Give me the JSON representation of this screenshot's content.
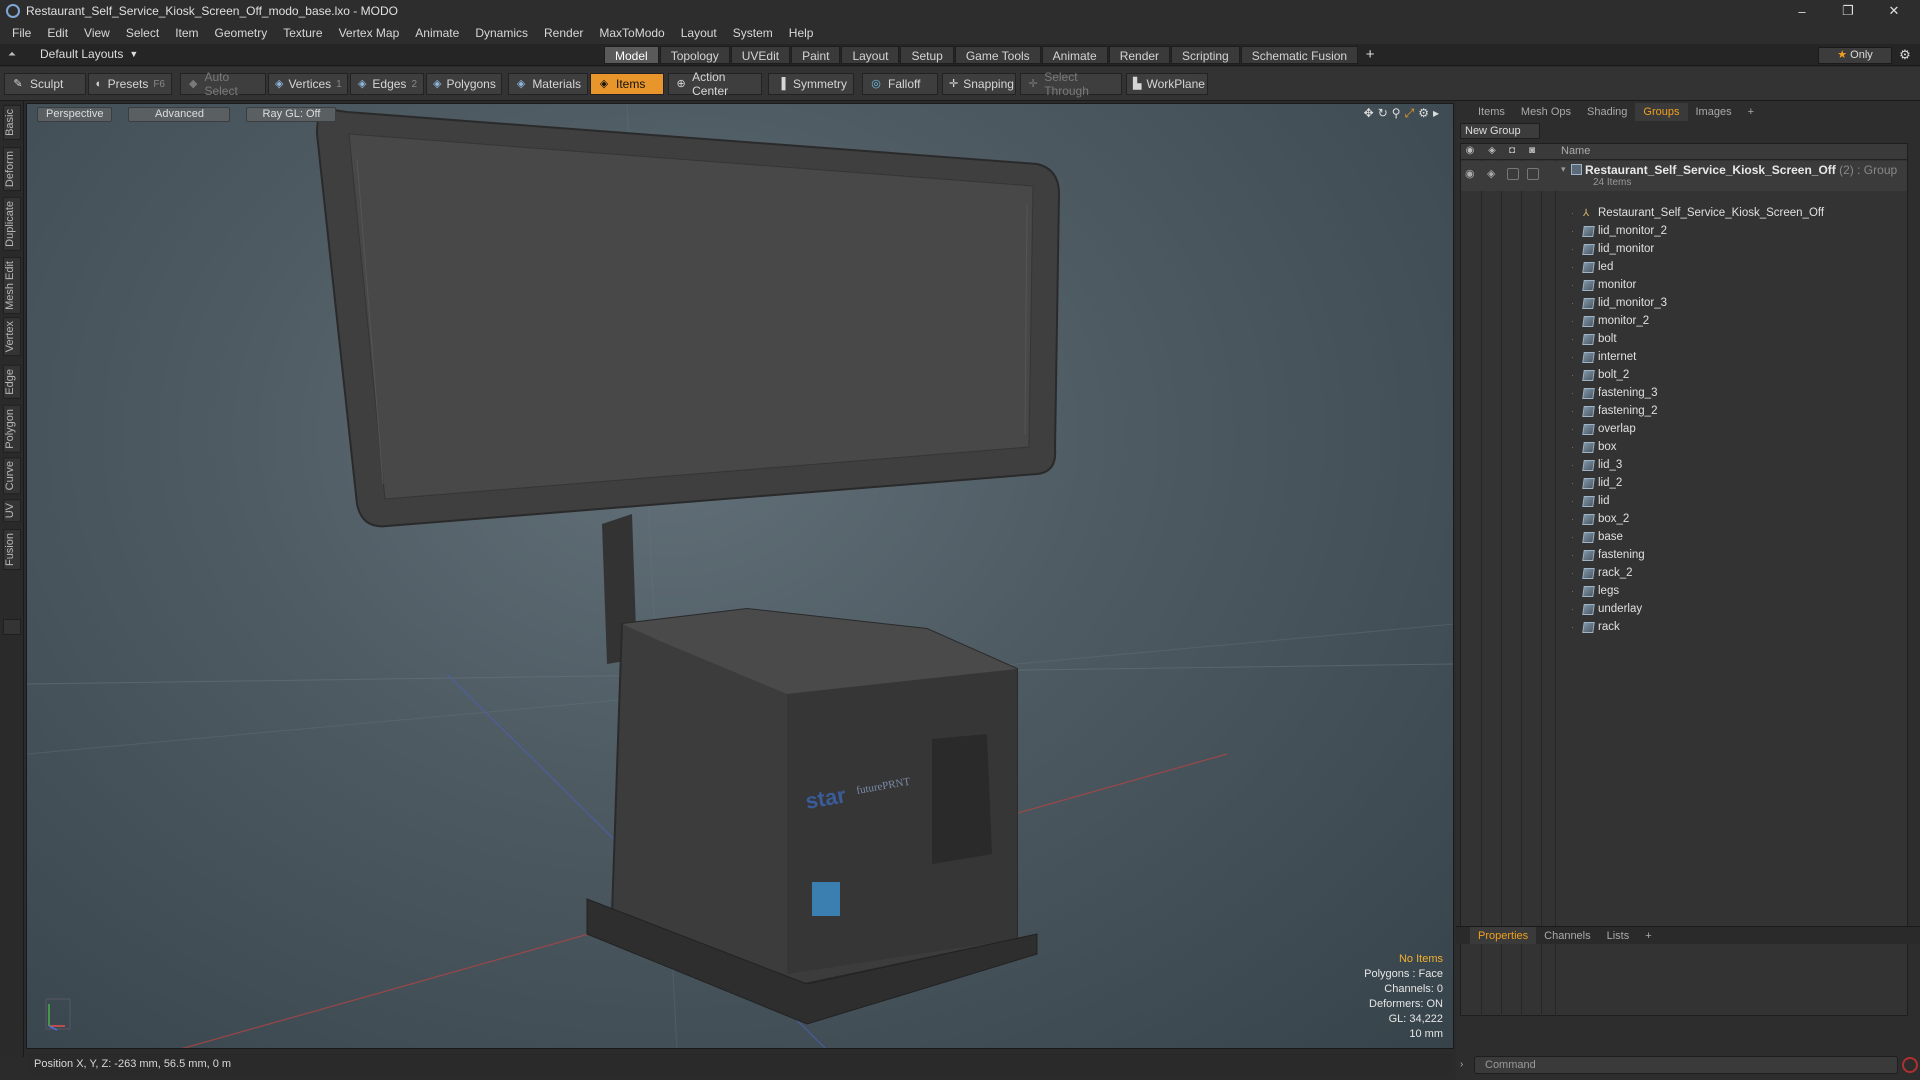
{
  "window": {
    "title": "Restaurant_Self_Service_Kiosk_Screen_Off_modo_base.lxo - MODO",
    "controls": [
      "–",
      "❐",
      "✕"
    ]
  },
  "menu": [
    "File",
    "Edit",
    "View",
    "Select",
    "Item",
    "Geometry",
    "Texture",
    "Vertex Map",
    "Animate",
    "Dynamics",
    "Render",
    "MaxToModo",
    "Layout",
    "System",
    "Help"
  ],
  "layouts": {
    "current": "Default Layouts",
    "tabs": [
      "Model",
      "Topology",
      "UVEdit",
      "Paint",
      "Layout",
      "Setup",
      "Game Tools",
      "Animate",
      "Render",
      "Scripting",
      "Schematic Fusion"
    ],
    "active": "Model",
    "only": "Only"
  },
  "toolbar": {
    "sculpt": "Sculpt",
    "presets": "Presets",
    "presets_key": "F6",
    "auto_select": "Auto Select",
    "vertices": "Vertices",
    "vertices_key": "1",
    "edges": "Edges",
    "edges_key": "2",
    "polygons": "Polygons",
    "materials": "Materials",
    "items": "Items",
    "action_center": "Action Center",
    "symmetry": "Symmetry",
    "falloff": "Falloff",
    "snapping": "Snapping",
    "select_through": "Select Through",
    "workplane": "WorkPlane"
  },
  "left_tabs": [
    "Basic",
    "Deform",
    "Duplicate",
    "Mesh Edit",
    "Vertex",
    "Edge",
    "Polygon",
    "Curve",
    "UV",
    "Fusion"
  ],
  "viewport": {
    "view": "Perspective",
    "shading": "Advanced",
    "raygl": "Ray GL: Off",
    "info": {
      "selection": "No Items",
      "polygons": "Polygons : Face",
      "channels": "Channels: 0",
      "deformers": "Deformers: ON",
      "gl": "GL: 34,222",
      "unit": "10 mm"
    },
    "printer_brand": "star",
    "printer_model": "futurePRNT"
  },
  "status": {
    "position": "Position X, Y, Z:   -263 mm, 56.5 mm, 0 m"
  },
  "right_panel": {
    "tabs": [
      "Items",
      "Mesh Ops",
      "Shading",
      "Groups",
      "Images"
    ],
    "active_tab": "Groups",
    "new_group": "New Group",
    "column_name": "Name",
    "group": {
      "name": "Restaurant_Self_Service_Kiosk_Screen_Off",
      "suffix": "(2) : Group",
      "count": "24 Items"
    },
    "items": [
      {
        "name": "Restaurant_Self_Service_Kiosk_Screen_Off",
        "icon": "locator-icon"
      },
      {
        "name": "lid_monitor_2",
        "icon": "mesh-icon"
      },
      {
        "name": "lid_monitor",
        "icon": "mesh-icon"
      },
      {
        "name": "led",
        "icon": "mesh-icon"
      },
      {
        "name": "monitor",
        "icon": "mesh-icon"
      },
      {
        "name": "lid_monitor_3",
        "icon": "mesh-icon"
      },
      {
        "name": "monitor_2",
        "icon": "mesh-icon"
      },
      {
        "name": "bolt",
        "icon": "mesh-icon"
      },
      {
        "name": "internet",
        "icon": "mesh-icon"
      },
      {
        "name": "bolt_2",
        "icon": "mesh-icon"
      },
      {
        "name": "fastening_3",
        "icon": "mesh-icon"
      },
      {
        "name": "fastening_2",
        "icon": "mesh-icon"
      },
      {
        "name": "overlap",
        "icon": "mesh-icon"
      },
      {
        "name": "box",
        "icon": "mesh-icon"
      },
      {
        "name": "lid_3",
        "icon": "mesh-icon"
      },
      {
        "name": "lid_2",
        "icon": "mesh-icon"
      },
      {
        "name": "lid",
        "icon": "mesh-icon"
      },
      {
        "name": "box_2",
        "icon": "mesh-icon"
      },
      {
        "name": "base",
        "icon": "mesh-icon"
      },
      {
        "name": "fastening",
        "icon": "mesh-icon"
      },
      {
        "name": "rack_2",
        "icon": "mesh-icon"
      },
      {
        "name": "legs",
        "icon": "mesh-icon"
      },
      {
        "name": "underlay",
        "icon": "mesh-icon"
      },
      {
        "name": "rack",
        "icon": "mesh-icon"
      }
    ],
    "bottom_tabs": [
      "Properties",
      "Channels",
      "Lists"
    ],
    "bottom_active": "Properties",
    "command_placeholder": "Command"
  },
  "colors": {
    "accent": "#e8952c",
    "active_tab_text": "#f0a020",
    "info_highlight": "#f0b030"
  }
}
